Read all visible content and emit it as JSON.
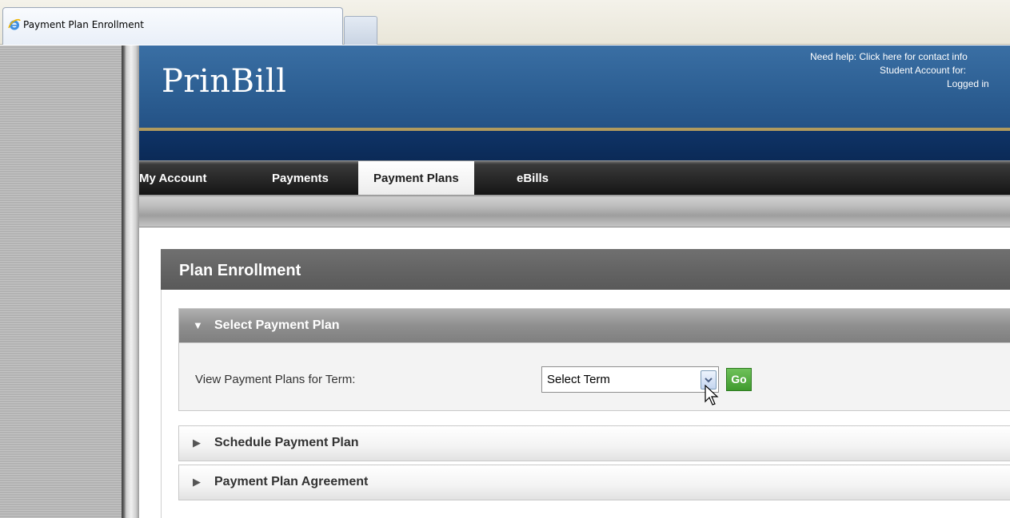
{
  "browser": {
    "tab_title": "Payment Plan Enrollment",
    "tab_icon": "ie-icon"
  },
  "header": {
    "logo": "PrinBill",
    "help_text": "Need help: Click here for contact info",
    "student_account": "Student Account for:",
    "logged_in": "Logged in"
  },
  "nav": {
    "items": [
      {
        "label": "My Account",
        "active": false
      },
      {
        "label": "Payments",
        "active": false
      },
      {
        "label": "Payment Plans",
        "active": true
      },
      {
        "label": "eBills",
        "active": false
      }
    ]
  },
  "panel": {
    "title": "Plan Enrollment",
    "sections": [
      {
        "label": "Select Payment Plan",
        "expanded": true,
        "arrow": "▼"
      },
      {
        "label": "Schedule Payment Plan",
        "expanded": false,
        "arrow": "▶"
      },
      {
        "label": "Payment Plan Agreement",
        "expanded": false,
        "arrow": "▶"
      }
    ],
    "term": {
      "label": "View Payment Plans for Term:",
      "select_value": "Select Term",
      "go_label": "Go"
    }
  },
  "colors": {
    "header_blue": "#2c5e92",
    "gold_rule": "#b09a5e",
    "navy_band": "#0f3467",
    "go_green": "#4fa83c",
    "panel_header": "#616161"
  }
}
